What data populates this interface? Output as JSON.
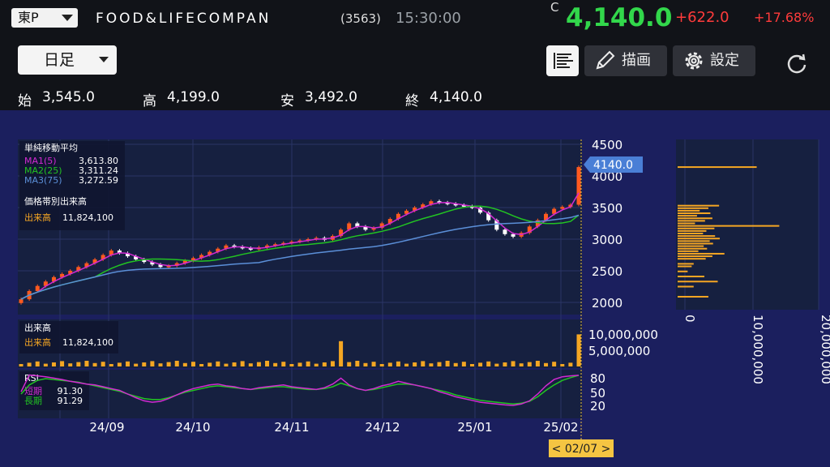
{
  "header": {
    "market": "東P",
    "title": "FOOD&LIFECOMPAN",
    "code": "(3563)",
    "time": "15:30:00",
    "close_tag": "C",
    "price": "4,140.0",
    "change": "+622.0",
    "change_pct": "+17.68%"
  },
  "toolbar": {
    "period": "日足",
    "draw_label": "描画",
    "settings_label": "設定"
  },
  "ohlc": {
    "open_label": "始",
    "open": "3,545.0",
    "high_label": "高",
    "high": "4,199.0",
    "low_label": "安",
    "low": "3,492.0",
    "close_label": "終",
    "close": "4,140.0"
  },
  "main_legend": {
    "title": "単純移動平均",
    "ma1_label": "MA1(5)",
    "ma1_value": "3,613.80",
    "ma2_label": "MA2(25)",
    "ma2_value": "3,311.24",
    "ma3_label": "MA3(75)",
    "ma3_value": "3,272.59",
    "vp_title": "価格帯別出来高",
    "vp_label": "出来高",
    "vp_value": "11,824,100"
  },
  "volume_legend": {
    "title": "出来高",
    "label": "出来高",
    "value": "11,824,100"
  },
  "rsi_legend": {
    "title": "RSI",
    "short_label": "短期",
    "short_value": "91.30",
    "long_label": "長期",
    "long_value": "91.29"
  },
  "price_axis": {
    "ticks": [
      "4500",
      "4000",
      "3500",
      "3000",
      "2500",
      "2000"
    ],
    "current_tag": "4140.0"
  },
  "volume_axis": {
    "ticks": [
      "10,000,000",
      "5,000,000"
    ]
  },
  "rsi_axis": {
    "ticks": [
      "80",
      "50",
      "20"
    ]
  },
  "date_axis": {
    "labels": [
      "24/09",
      "24/10",
      "24/11",
      "24/12",
      "25/01",
      "25/02"
    ]
  },
  "crosshair_date": "< 02/07 >",
  "vp_axis": {
    "ticks": [
      "0",
      "10,000,000",
      "20,000,000"
    ]
  },
  "colors": {
    "up": "#ff5a1f",
    "down": "#ffffff",
    "ma1": "#d22ad2",
    "ma2": "#22c322",
    "ma3": "#5b8fd8",
    "volume": "#f5a623",
    "rsi_short": "#d22ad2",
    "rsi_long": "#22c322",
    "price_green": "#32d74b",
    "change_red": "#ff3b3b"
  },
  "chart_data": {
    "type": "candlestick",
    "price_range": [
      1900,
      4600
    ],
    "closes": [
      2050,
      2180,
      2260,
      2330,
      2400,
      2450,
      2500,
      2560,
      2620,
      2680,
      2750,
      2820,
      2780,
      2730,
      2680,
      2640,
      2600,
      2560,
      2580,
      2620,
      2660,
      2700,
      2750,
      2800,
      2850,
      2900,
      2880,
      2860,
      2840,
      2870,
      2900,
      2920,
      2940,
      2960,
      2980,
      3000,
      3020,
      2990,
      3050,
      3150,
      3250,
      3200,
      3150,
      3180,
      3250,
      3320,
      3400,
      3450,
      3500,
      3550,
      3600,
      3580,
      3560,
      3540,
      3520,
      3500,
      3420,
      3300,
      3150,
      3080,
      3040,
      3100,
      3200,
      3300,
      3400,
      3480,
      3510,
      3545,
      4140
    ],
    "rsi_short": [
      55,
      92,
      90,
      88,
      85,
      82,
      78,
      75,
      72,
      70,
      66,
      62,
      58,
      50,
      42,
      35,
      32,
      34,
      40,
      48,
      56,
      62,
      66,
      70,
      72,
      68,
      66,
      62,
      60,
      64,
      66,
      68,
      70,
      66,
      64,
      62,
      60,
      64,
      72,
      85,
      70,
      62,
      58,
      62,
      68,
      72,
      78,
      74,
      70,
      66,
      62,
      55,
      50,
      44,
      40,
      36,
      32,
      30,
      28,
      26,
      25,
      28,
      35,
      50,
      68,
      82,
      88,
      90,
      91.3
    ],
    "rsi_long": [
      50,
      70,
      80,
      84,
      82,
      80,
      78,
      76,
      72,
      68,
      64,
      60,
      56,
      50,
      45,
      40,
      38,
      38,
      42,
      48,
      54,
      58,
      62,
      66,
      68,
      66,
      64,
      62,
      60,
      62,
      64,
      66,
      66,
      64,
      62,
      60,
      60,
      62,
      66,
      74,
      68,
      62,
      58,
      60,
      64,
      68,
      72,
      72,
      70,
      66,
      62,
      58,
      54,
      48,
      44,
      40,
      36,
      34,
      32,
      30,
      28,
      30,
      34,
      44,
      58,
      70,
      80,
      86,
      91.29
    ],
    "vp_max": 20000000,
    "vp_bins": [
      {
        "price": 4140,
        "volume": 11824100
      },
      {
        "price": 3530,
        "volume": 6200000
      },
      {
        "price": 3490,
        "volume": 4600000
      },
      {
        "price": 3450,
        "volume": 3300000
      },
      {
        "price": 3410,
        "volume": 4900000
      },
      {
        "price": 3370,
        "volume": 2900000
      },
      {
        "price": 3330,
        "volume": 5200000
      },
      {
        "price": 3290,
        "volume": 4100000
      },
      {
        "price": 3250,
        "volume": 2600000
      },
      {
        "price": 3210,
        "volume": 15200000
      },
      {
        "price": 3170,
        "volume": 5500000
      },
      {
        "price": 3130,
        "volume": 4300000
      },
      {
        "price": 3090,
        "volume": 3800000
      },
      {
        "price": 3050,
        "volume": 5600000
      },
      {
        "price": 3010,
        "volume": 6300000
      },
      {
        "price": 2970,
        "volume": 4800000
      },
      {
        "price": 2930,
        "volume": 5300000
      },
      {
        "price": 2890,
        "volume": 3900000
      },
      {
        "price": 2850,
        "volume": 4400000
      },
      {
        "price": 2810,
        "volume": 3100000
      },
      {
        "price": 2770,
        "volume": 7000000
      },
      {
        "price": 2730,
        "volume": 5200000
      },
      {
        "price": 2690,
        "volume": 4200000
      },
      {
        "price": 2610,
        "volume": 2400000
      },
      {
        "price": 2570,
        "volume": 2100000
      },
      {
        "price": 2490,
        "volume": 1500000
      },
      {
        "price": 2410,
        "volume": 4000000
      },
      {
        "price": 2330,
        "volume": 6000000
      },
      {
        "price": 2250,
        "volume": 2400000
      },
      {
        "price": 2090,
        "volume": 4600000
      }
    ]
  }
}
